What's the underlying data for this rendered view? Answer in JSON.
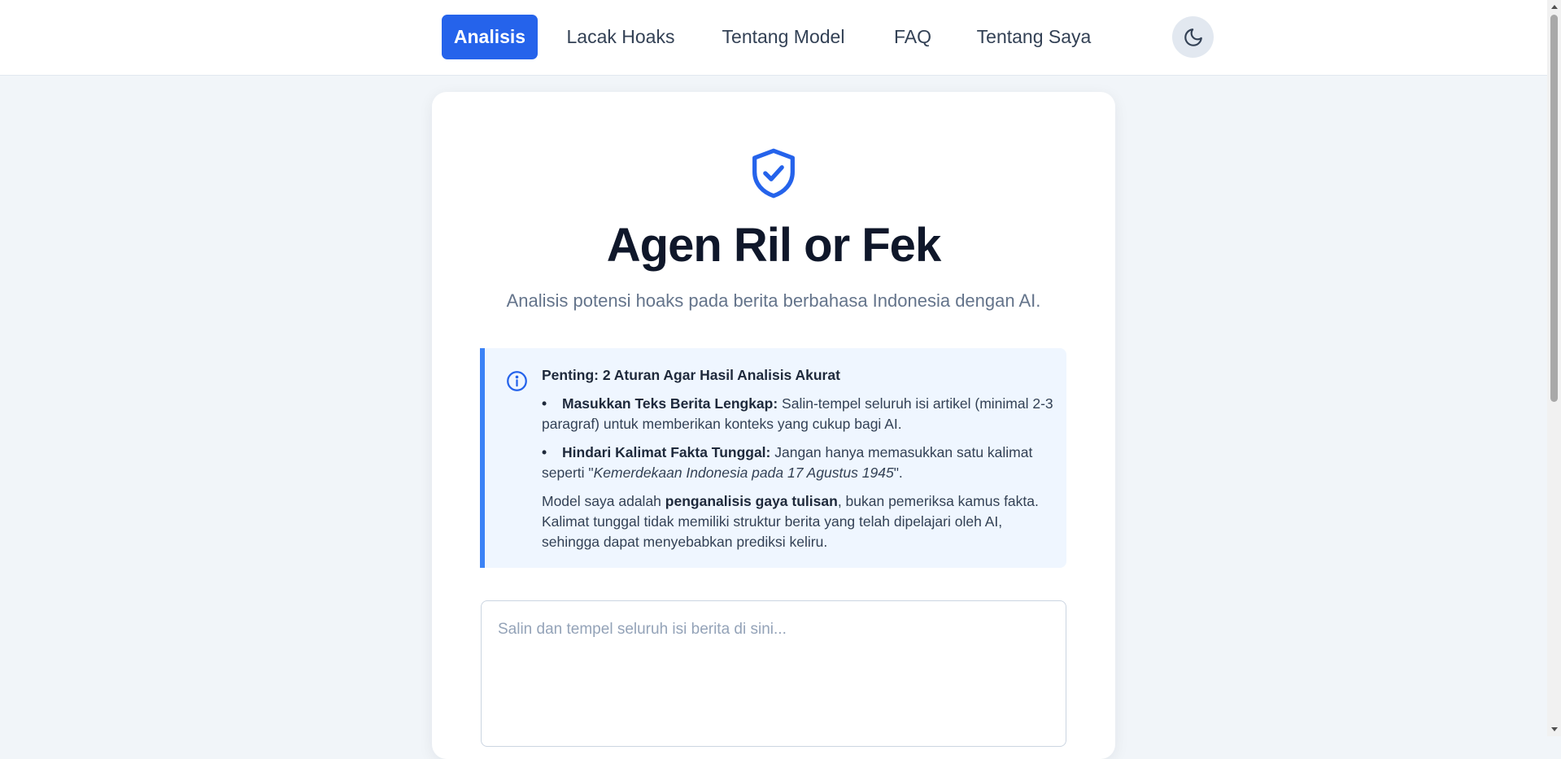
{
  "nav": {
    "items": [
      {
        "label": "Analisis",
        "active": true
      },
      {
        "label": "Lacak Hoaks",
        "active": false
      },
      {
        "label": "Tentang Model",
        "active": false
      },
      {
        "label": "FAQ",
        "active": false
      },
      {
        "label": "Tentang Saya",
        "active": false
      }
    ],
    "theme_toggle_icon": "moon-icon"
  },
  "hero": {
    "icon": "shield-check-icon",
    "title": "Agen Ril or Fek",
    "subtitle": "Analisis potensi hoaks pada berita berbahasa Indonesia dengan AI."
  },
  "notice": {
    "icon": "info-icon",
    "title": "Penting: 2 Aturan Agar Hasil Analisis Akurat",
    "rules": [
      {
        "bold": "Masukkan Teks Berita Lengkap:",
        "text": " Salin-tempel seluruh isi artikel (minimal 2-3 paragraf) untuk memberikan konteks yang cukup bagi AI."
      },
      {
        "bold": "Hindari Kalimat Fakta Tunggal:",
        "text": " Jangan hanya memasukkan satu kalimat seperti \"",
        "italic": "Kemerdekaan Indonesia pada 17 Agustus 1945",
        "text_end": "\"."
      }
    ],
    "note": {
      "before": "Model saya adalah ",
      "bold": "penganalisis gaya tulisan",
      "after": ", bukan pemeriksa kamus fakta. Kalimat tunggal tidak memiliki struktur berita yang telah dipelajari oleh AI, sehingga dapat menyebabkan prediksi keliru."
    }
  },
  "input": {
    "placeholder": "Salin dan tempel seluruh isi berita di sini...",
    "value": ""
  },
  "colors": {
    "accent": "#2563eb",
    "page_bg": "#f1f5f9",
    "notice_bg": "#eff6ff",
    "notice_border": "#3b82f6"
  }
}
